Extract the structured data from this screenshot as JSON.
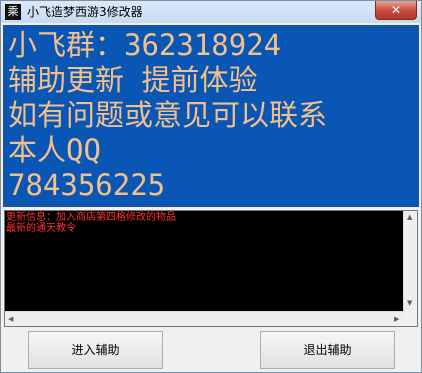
{
  "window": {
    "title": "小飞造梦西游3修改器",
    "icon_glyph": "乘",
    "close_label": "✕"
  },
  "banner": {
    "lines": [
      "小飞群：362318924",
      "辅助更新 提前体验",
      "如有问题或意见可以联系",
      "本人QQ",
      "784356225"
    ],
    "text_color": "#f2c08a",
    "background": "#0a56b4"
  },
  "log": {
    "lines": [
      "更新信息：加入商店第四格修改的物品",
      "最新的通天教令"
    ],
    "text_color": "#ff3030"
  },
  "scroll": {
    "up": "▲",
    "down": "▼",
    "left": "◀",
    "right": "▶"
  },
  "buttons": {
    "enter_label": "进入辅助",
    "exit_label": "退出辅助"
  }
}
